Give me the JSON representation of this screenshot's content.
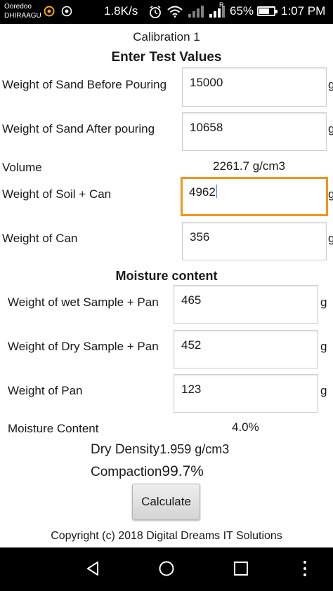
{
  "status_bar": {
    "carrier_line1": "Ooredoo",
    "carrier_line2": "DHIRAAGU",
    "net_speed": "1.8K/s",
    "signal_label": "R",
    "battery": "65%",
    "battery_level": 0.65,
    "time": "1:07 PM",
    "icons": [
      "carrier-logo-icon",
      "eye-icon",
      "alarm-icon",
      "wifi-icon",
      "signal-icon",
      "battery-icon"
    ]
  },
  "page": {
    "title": "Calibration 1",
    "heading": "Enter Test  Values"
  },
  "calibration": {
    "sand_before": {
      "label": "Weight of Sand Before Pouring",
      "value": "15000",
      "unit": "g"
    },
    "sand_after": {
      "label": "Weight of Sand After pouring",
      "value": "10658",
      "unit": "g"
    },
    "volume": {
      "label": "Volume",
      "value": "2261.7 g/cm3"
    },
    "soil_can": {
      "label": "Weight of Soil + Can",
      "value": "4962",
      "unit": "g"
    },
    "can": {
      "label": "Weight of Can",
      "value": "356",
      "unit": "g"
    }
  },
  "moisture": {
    "heading": "Moisture content",
    "wet_sample": {
      "label": "Weight of wet Sample + Pan",
      "value": "465",
      "unit": "g"
    },
    "dry_sample": {
      "label": "Weight of Dry Sample + Pan",
      "value": "452",
      "unit": "g"
    },
    "pan": {
      "label": "Weight of Pan",
      "value": "123",
      "unit": "g"
    },
    "content": {
      "label": "Moisture Content",
      "value": "4.0%"
    }
  },
  "results": {
    "dry_density_label": "Dry Density",
    "dry_density_value": "1.959 g/cm3",
    "compaction_label": "Compaction",
    "compaction_value": "99.7%"
  },
  "actions": {
    "calculate_label": "Calculate"
  },
  "footer": {
    "copyright": "Copyright (c) 2018 Digital Dreams IT Solutions"
  },
  "nav_bar": {
    "icons": [
      "back-icon",
      "home-icon",
      "recents-icon",
      "more-icon"
    ]
  },
  "colors": {
    "focus_border": "#f0961e",
    "caret": "#3f7de0",
    "system_bars": "#000000"
  }
}
